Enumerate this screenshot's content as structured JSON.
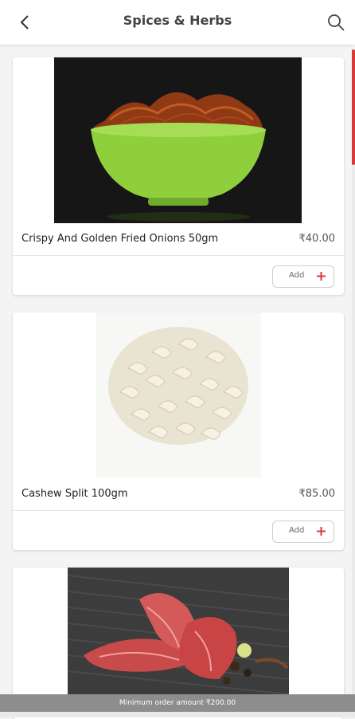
{
  "header": {
    "title": "Spices & Herbs"
  },
  "products": [
    {
      "name": "Crispy And Golden Fried Onions 50gm",
      "price": "₹40.00",
      "add_label": "Add"
    },
    {
      "name": "Cashew Split 100gm",
      "price": "₹85.00",
      "add_label": "Add"
    },
    {
      "name": "",
      "price": "",
      "add_label": ""
    }
  ],
  "footer": {
    "min_order_text": "Minimum order amount ₹200.00"
  },
  "colors": {
    "accent": "#d83a3a",
    "bowl_green": "#8fcf3c"
  }
}
